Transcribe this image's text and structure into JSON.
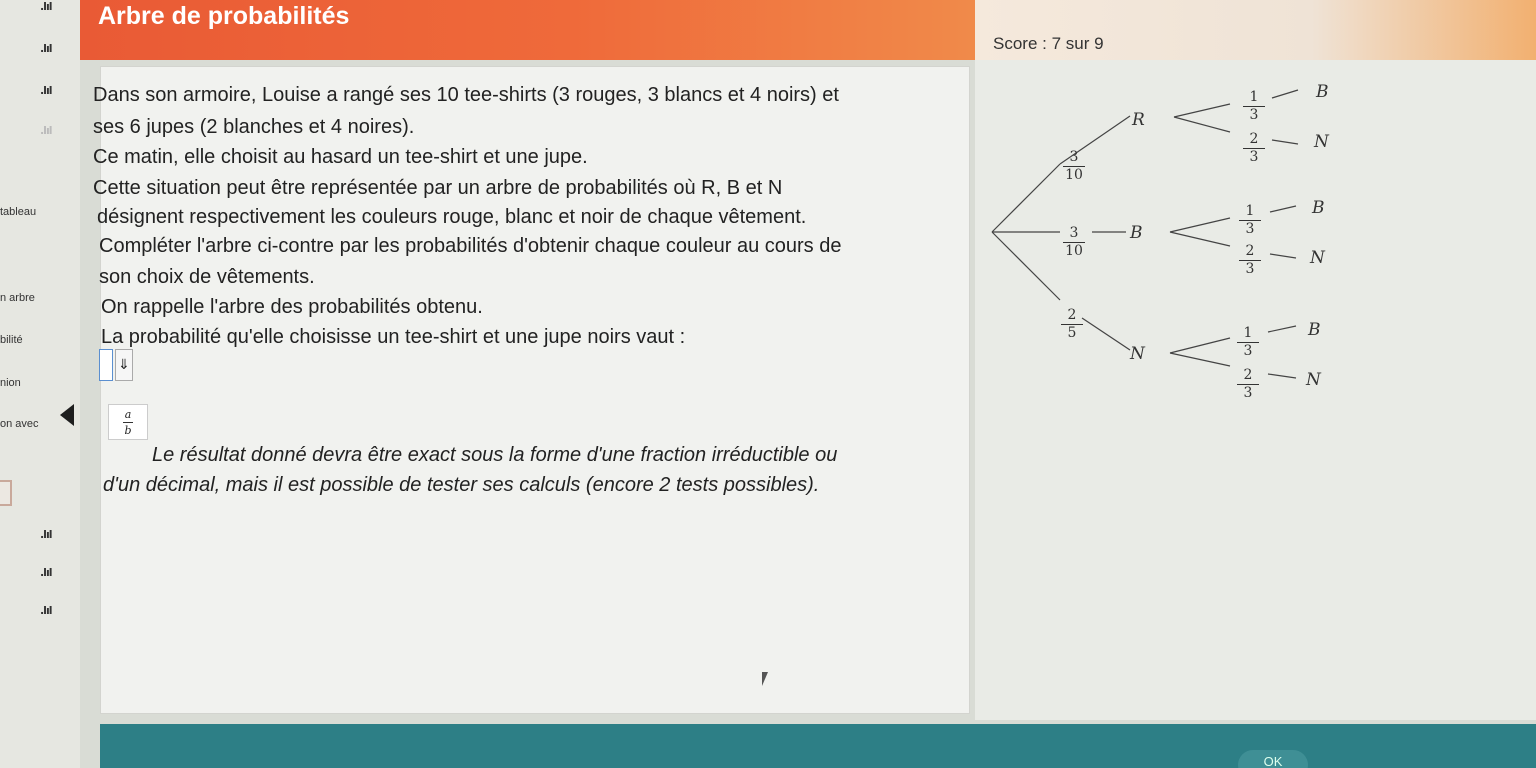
{
  "header": {
    "title": "Arbre de probabilités",
    "score": "Score : 7 sur 9"
  },
  "sidebar": {
    "icon_glyph": ".lıl",
    "labels": [
      "tableau",
      "n arbre",
      "bilité",
      "nion",
      "on avec"
    ]
  },
  "exercise": {
    "lines": [
      "Dans son armoire, Louise a rangé ses 10 tee-shirts (3 rouges, 3 blancs et 4 noirs) et",
      "ses 6 jupes (2 blanches et 4 noires).",
      "Ce matin, elle choisit au hasard un tee-shirt et une jupe.",
      "Cette situation peut être représentée par un arbre de probabilités où R, B et N",
      "désignent respectivement les couleurs rouge, blanc et noir de chaque vêtement.",
      "Compléter l'arbre ci-contre par les probabilités d'obtenir chaque couleur au cours de",
      "son choix de vêtements.",
      "On rappelle l'arbre des probabilités obtenu.",
      "La probabilité qu'elle choisisse un tee-shirt et une jupe noirs vaut :"
    ],
    "input_value": "",
    "input_button_glyph": "⇓",
    "fraction_button": {
      "numerator": "a",
      "denominator": "b"
    },
    "note_lines": [
      "Le résultat donné devra être exact sous la forme d'une fraction irréductible ou",
      "d'un décimal, mais il est possible de tester ses calculs (encore 2 tests possibles)."
    ]
  },
  "tree": {
    "level1": [
      {
        "label": "R",
        "num": "3",
        "den": "10"
      },
      {
        "label": "B",
        "num": "3",
        "den": "10"
      },
      {
        "label": "N",
        "num": "2",
        "den": "5"
      }
    ],
    "level2": [
      {
        "label": "B",
        "num": "1",
        "den": "3"
      },
      {
        "label": "N",
        "num": "2",
        "den": "3"
      },
      {
        "label": "B",
        "num": "1",
        "den": "3"
      },
      {
        "label": "N",
        "num": "2",
        "den": "3"
      },
      {
        "label": "B",
        "num": "1",
        "den": "3"
      },
      {
        "label": "N",
        "num": "2",
        "den": "3"
      }
    ]
  },
  "footer": {
    "ok_label": "OK"
  },
  "colors": {
    "header": "#ee6a3a",
    "footer": "#2d7f86",
    "panel": "#f1f2ef"
  }
}
